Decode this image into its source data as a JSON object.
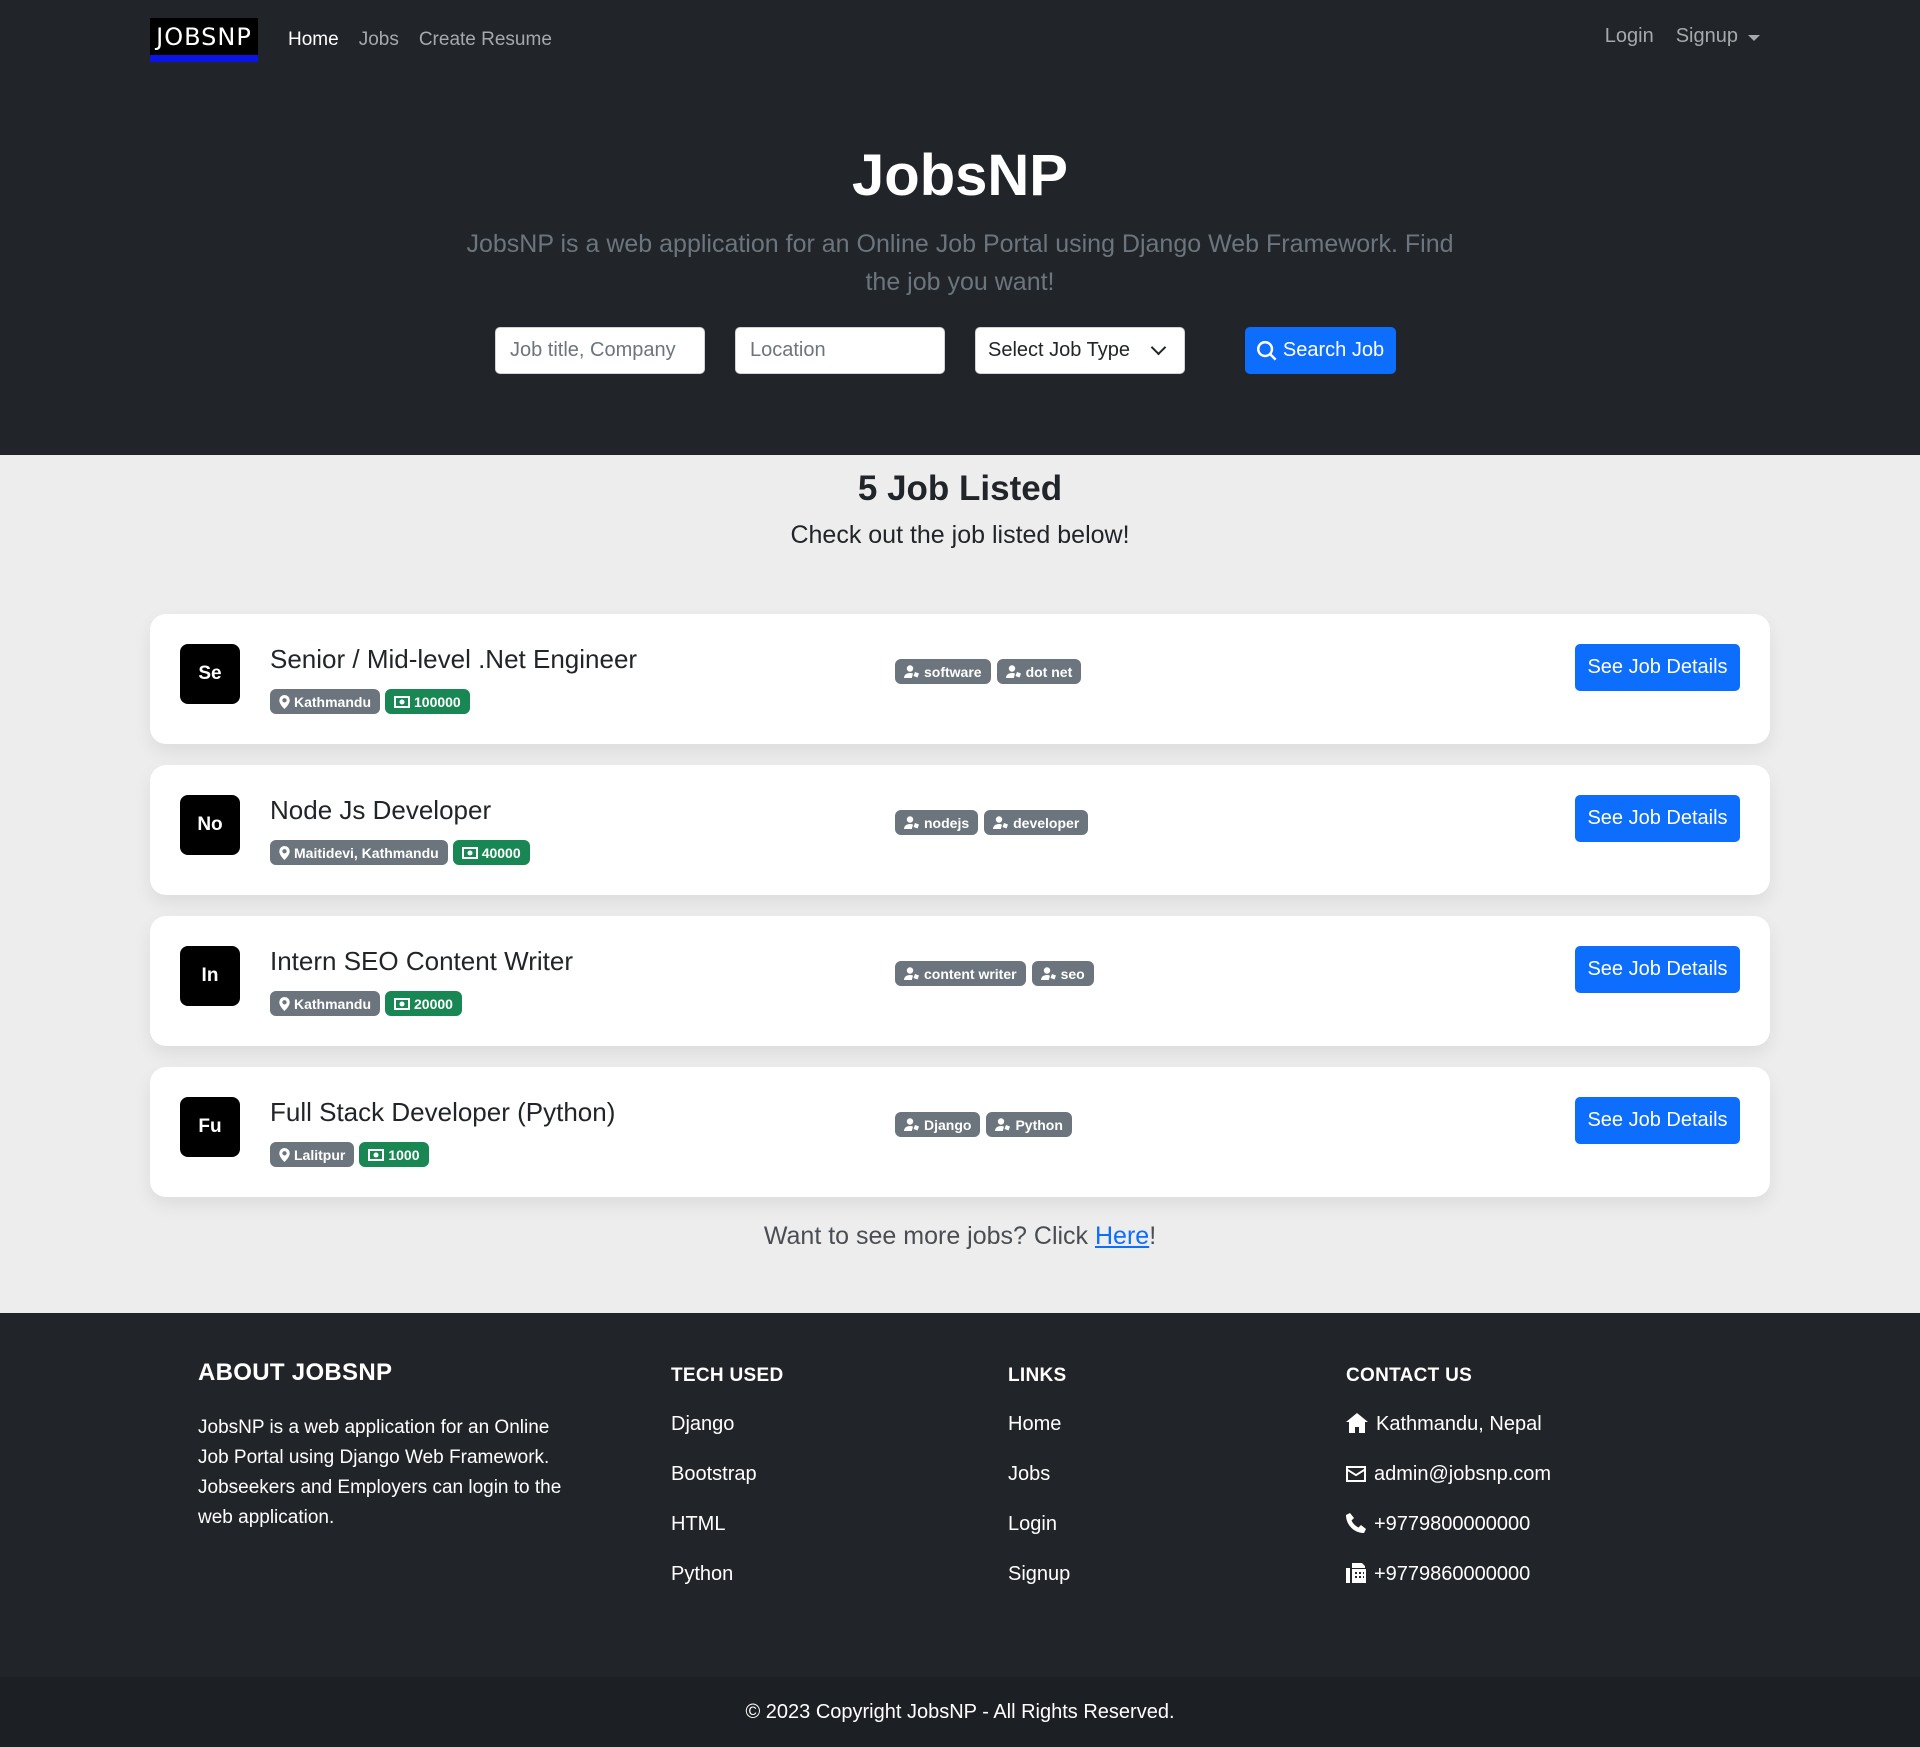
{
  "nav": {
    "brand": "JOBSNP",
    "links": [
      "Home",
      "Jobs",
      "Create Resume"
    ],
    "login": "Login",
    "signup": "Signup"
  },
  "hero": {
    "title": "JobsNP",
    "subtitle": "JobsNP is a web application for an Online Job Portal using Django Web Framework. Find the job you want!",
    "search_placeholder": "Job title, Company",
    "location_placeholder": "Location",
    "job_type_value": "Select Job Type",
    "search_button": "Search Job"
  },
  "listing": {
    "title": "5 Job Listed",
    "subtitle": "Check out the job listed below!",
    "jobs": [
      {
        "initials": "Se",
        "title": "Senior / Mid-level .Net Engineer",
        "location": "Kathmandu",
        "salary": "100000",
        "tags": [
          "software",
          "dot net"
        ],
        "button": "See Job Details"
      },
      {
        "initials": "No",
        "title": "Node Js Developer",
        "location": "Maitidevi, Kathmandu",
        "salary": "40000",
        "tags": [
          "nodejs",
          "developer"
        ],
        "button": "See Job Details"
      },
      {
        "initials": "In",
        "title": "Intern SEO Content Writer",
        "location": "Kathmandu",
        "salary": "20000",
        "tags": [
          "content writer",
          "seo"
        ],
        "button": "See Job Details"
      },
      {
        "initials": "Fu",
        "title": "Full Stack Developer (Python)",
        "location": "Lalitpur",
        "salary": "1000",
        "tags": [
          "Django",
          "Python"
        ],
        "button": "See Job Details"
      }
    ],
    "more_text": "Want to see more jobs? Click ",
    "more_link": "Here",
    "more_suffix": "!"
  },
  "footer": {
    "about_title": "ABOUT JOBSNP",
    "about_text": "JobsNP is a web application for an Online Job Portal using Django Web Framework. Jobseekers and Employers can login to the web application.",
    "tech_title": "TECH USED",
    "tech": [
      "Django",
      "Bootstrap",
      "HTML",
      "Python"
    ],
    "links_title": "LINKS",
    "links": [
      "Home",
      "Jobs",
      "Login",
      "Signup"
    ],
    "contact_title": "CONTACT US",
    "contact": {
      "address": "Kathmandu, Nepal",
      "email": "admin@jobsnp.com",
      "phone": "+9779800000000",
      "fax": "+9779860000000"
    },
    "copyright": "© 2023 Copyright JobsNP - All Rights Reserved."
  },
  "colors": {
    "primary": "#0d6efd",
    "dark": "#212529",
    "success": "#198754",
    "secondary": "#6c757d",
    "brand_underline": "#0a14e6"
  },
  "icons": [
    "search-icon",
    "map-pin-icon",
    "money-icon",
    "user-tag-icon",
    "home-icon",
    "envelope-icon",
    "phone-icon",
    "fax-icon",
    "caret-down-icon",
    "chevron-down-icon"
  ]
}
